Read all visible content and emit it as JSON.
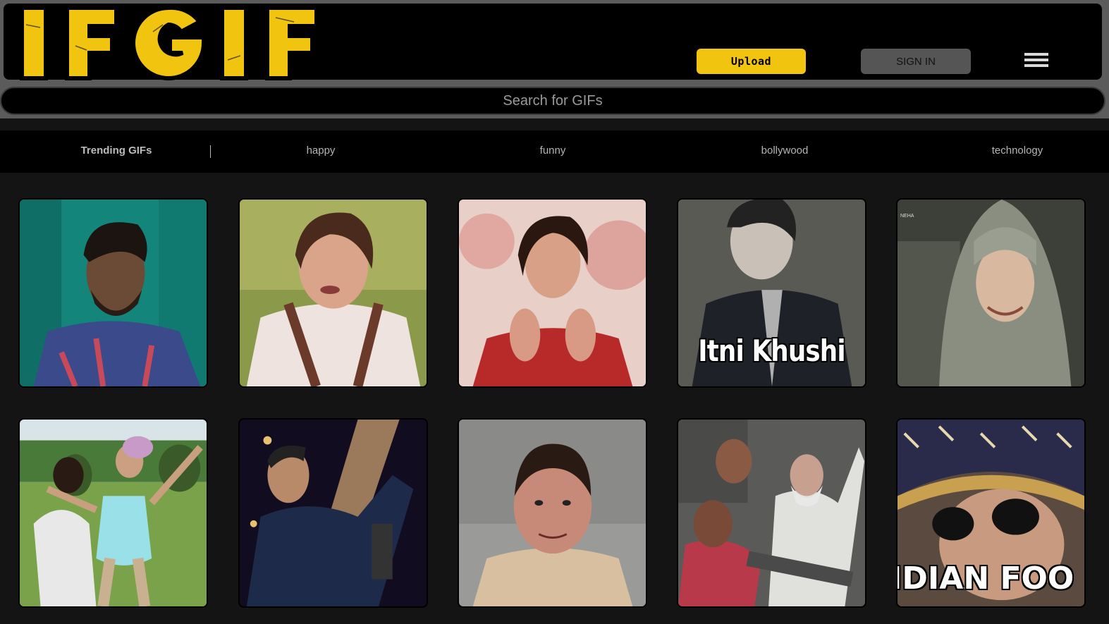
{
  "app": {
    "logo_text": "IFGIF",
    "accent_color": "#f1c40f"
  },
  "header": {
    "upload_label": "Upload",
    "signin_label": "SIGN IN",
    "menu_icon": "hamburger-icon"
  },
  "search": {
    "placeholder": "Search for GIFs"
  },
  "categories": {
    "items": [
      {
        "label": "Trending GIFs"
      },
      {
        "label": "happy"
      },
      {
        "label": "funny"
      },
      {
        "label": "bollywood"
      },
      {
        "label": "technology"
      }
    ]
  },
  "gifs": [
    {
      "caption": ""
    },
    {
      "caption": ""
    },
    {
      "caption": ""
    },
    {
      "caption": "Itni Khushi"
    },
    {
      "caption": "",
      "watermark": "NEHA"
    },
    {
      "caption": ""
    },
    {
      "caption": ""
    },
    {
      "caption": ""
    },
    {
      "caption": ""
    },
    {
      "caption": "IDIAN FOO"
    }
  ]
}
